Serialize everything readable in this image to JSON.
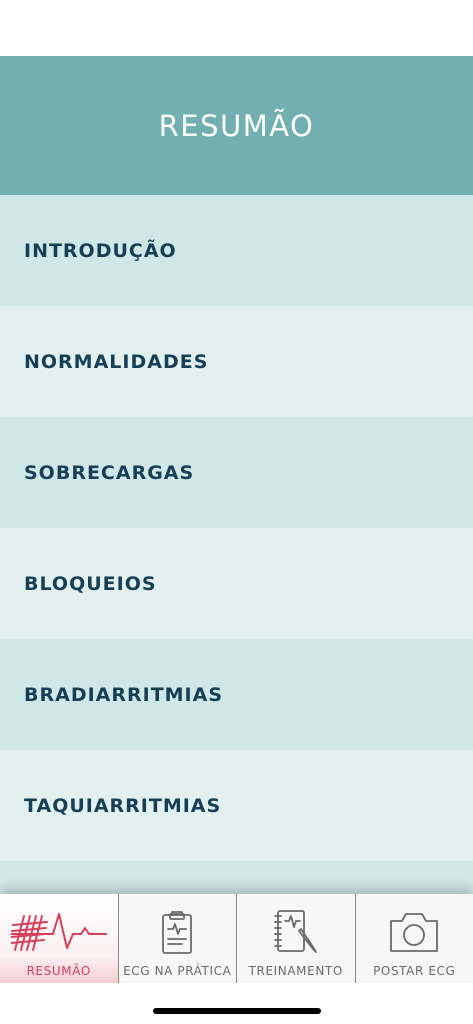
{
  "header": {
    "title": "RESUMÃO"
  },
  "menu": {
    "items": [
      {
        "label": "INTRODUÇÃO"
      },
      {
        "label": "NORMALIDADES"
      },
      {
        "label": "SOBRECARGAS"
      },
      {
        "label": "BLOQUEIOS"
      },
      {
        "label": "BRADIARRITMIAS"
      },
      {
        "label": "TAQUIARRITMIAS"
      },
      {
        "label": ""
      }
    ]
  },
  "tabbar": {
    "tabs": [
      {
        "label": "RESUMÃO",
        "icon": "ecg-heartbeat-icon",
        "active": true
      },
      {
        "label": "ECG NA PRÁTICA",
        "icon": "clipboard-ecg-icon",
        "active": false
      },
      {
        "label": "TREINAMENTO",
        "icon": "notebook-pencil-icon",
        "active": false
      },
      {
        "label": "POSTAR ECG",
        "icon": "camera-icon",
        "active": false
      }
    ]
  },
  "colors": {
    "header_bg": "#72afb1",
    "row_dark": "#d0e7e7",
    "row_light": "#e2f0ef",
    "menu_text": "#163f57",
    "active_tab": "#d6405a"
  }
}
